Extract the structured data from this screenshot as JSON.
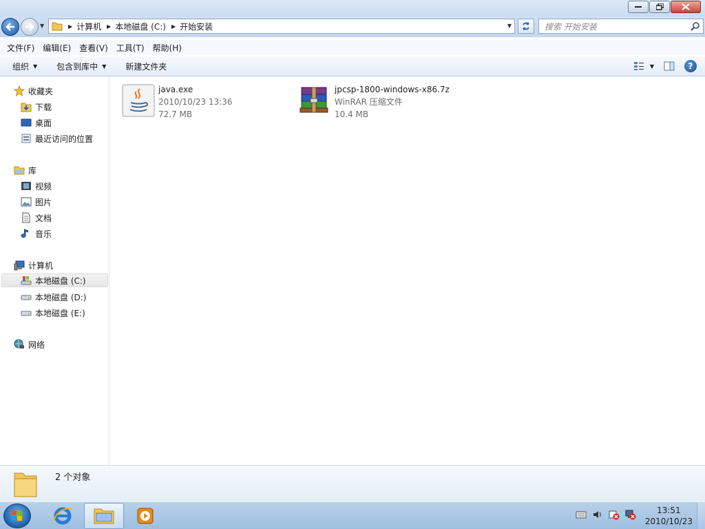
{
  "titlebar": {
    "buttons": [
      "minimize",
      "maximize",
      "close"
    ]
  },
  "address": {
    "crumbs": [
      "计算机",
      "本地磁盘 (C:)",
      "开始安装"
    ]
  },
  "search": {
    "placeholder": "搜索 开始安装"
  },
  "menu": [
    "文件(F)",
    "编辑(E)",
    "查看(V)",
    "工具(T)",
    "帮助(H)"
  ],
  "toolbar": {
    "organize": "组织",
    "include_library": "包含到库中",
    "new_folder": "新建文件夹"
  },
  "nav": {
    "favorites": {
      "label": "收藏夹",
      "items": [
        "下载",
        "桌面",
        "最近访问的位置"
      ]
    },
    "libraries": {
      "label": "库",
      "items": [
        "视频",
        "图片",
        "文档",
        "音乐"
      ]
    },
    "computer": {
      "label": "计算机",
      "items": [
        "本地磁盘 (C:)",
        "本地磁盘 (D:)",
        "本地磁盘 (E:)"
      ]
    },
    "network": {
      "label": "网络"
    }
  },
  "files": [
    {
      "name": "java.exe",
      "line2": "2010/10/23 13:36",
      "line3": "72.7 MB",
      "icon": "java-icon"
    },
    {
      "name": "jpcsp-1800-windows-x86.7z",
      "line2": "WinRAR 压缩文件",
      "line3": "10.4 MB",
      "icon": "winrar-icon"
    }
  ],
  "details": {
    "count": "2 个对象"
  },
  "taskbar": {
    "time": "13:51",
    "date": "2010/10/23"
  },
  "colors": {
    "selection": "#e7e7e7",
    "accent": "#1d58a6"
  }
}
